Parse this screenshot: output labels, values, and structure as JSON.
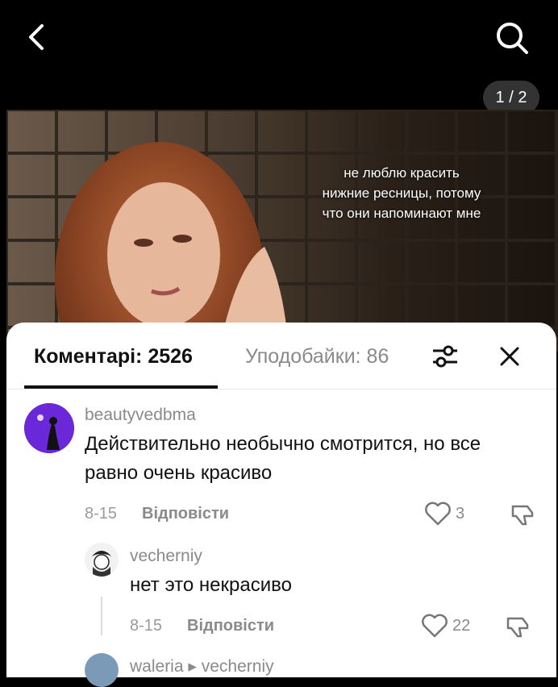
{
  "header": {
    "back_icon": "chevron-left-icon",
    "search_icon": "search-icon"
  },
  "post": {
    "page_indicator": "1 / 2",
    "caption": "не люблю красить\nнижние ресницы, потому\nчто они напоминают мне"
  },
  "comments_panel": {
    "tab_comments": "Коментарі: 2526",
    "tab_likes": "Уподобайки: 86",
    "filter_icon": "sliders-icon",
    "close_icon": "close-icon",
    "comments": [
      {
        "username": "beautyvedbma",
        "text": "Действительно необычно смотрится, но все равно очень красиво",
        "date": "8-15",
        "reply_label": "Відповісти",
        "likes": "3"
      }
    ],
    "replies": [
      {
        "username": "vecherniy",
        "text": "нет это некрасиво",
        "date": "8-15",
        "reply_label": "Відповісти",
        "likes": "22"
      },
      {
        "username": "waleria ▸ vecherniy"
      }
    ]
  },
  "colors": {
    "background": "#000000",
    "sheet": "#ffffff",
    "muted_text": "#8a8a8a"
  }
}
